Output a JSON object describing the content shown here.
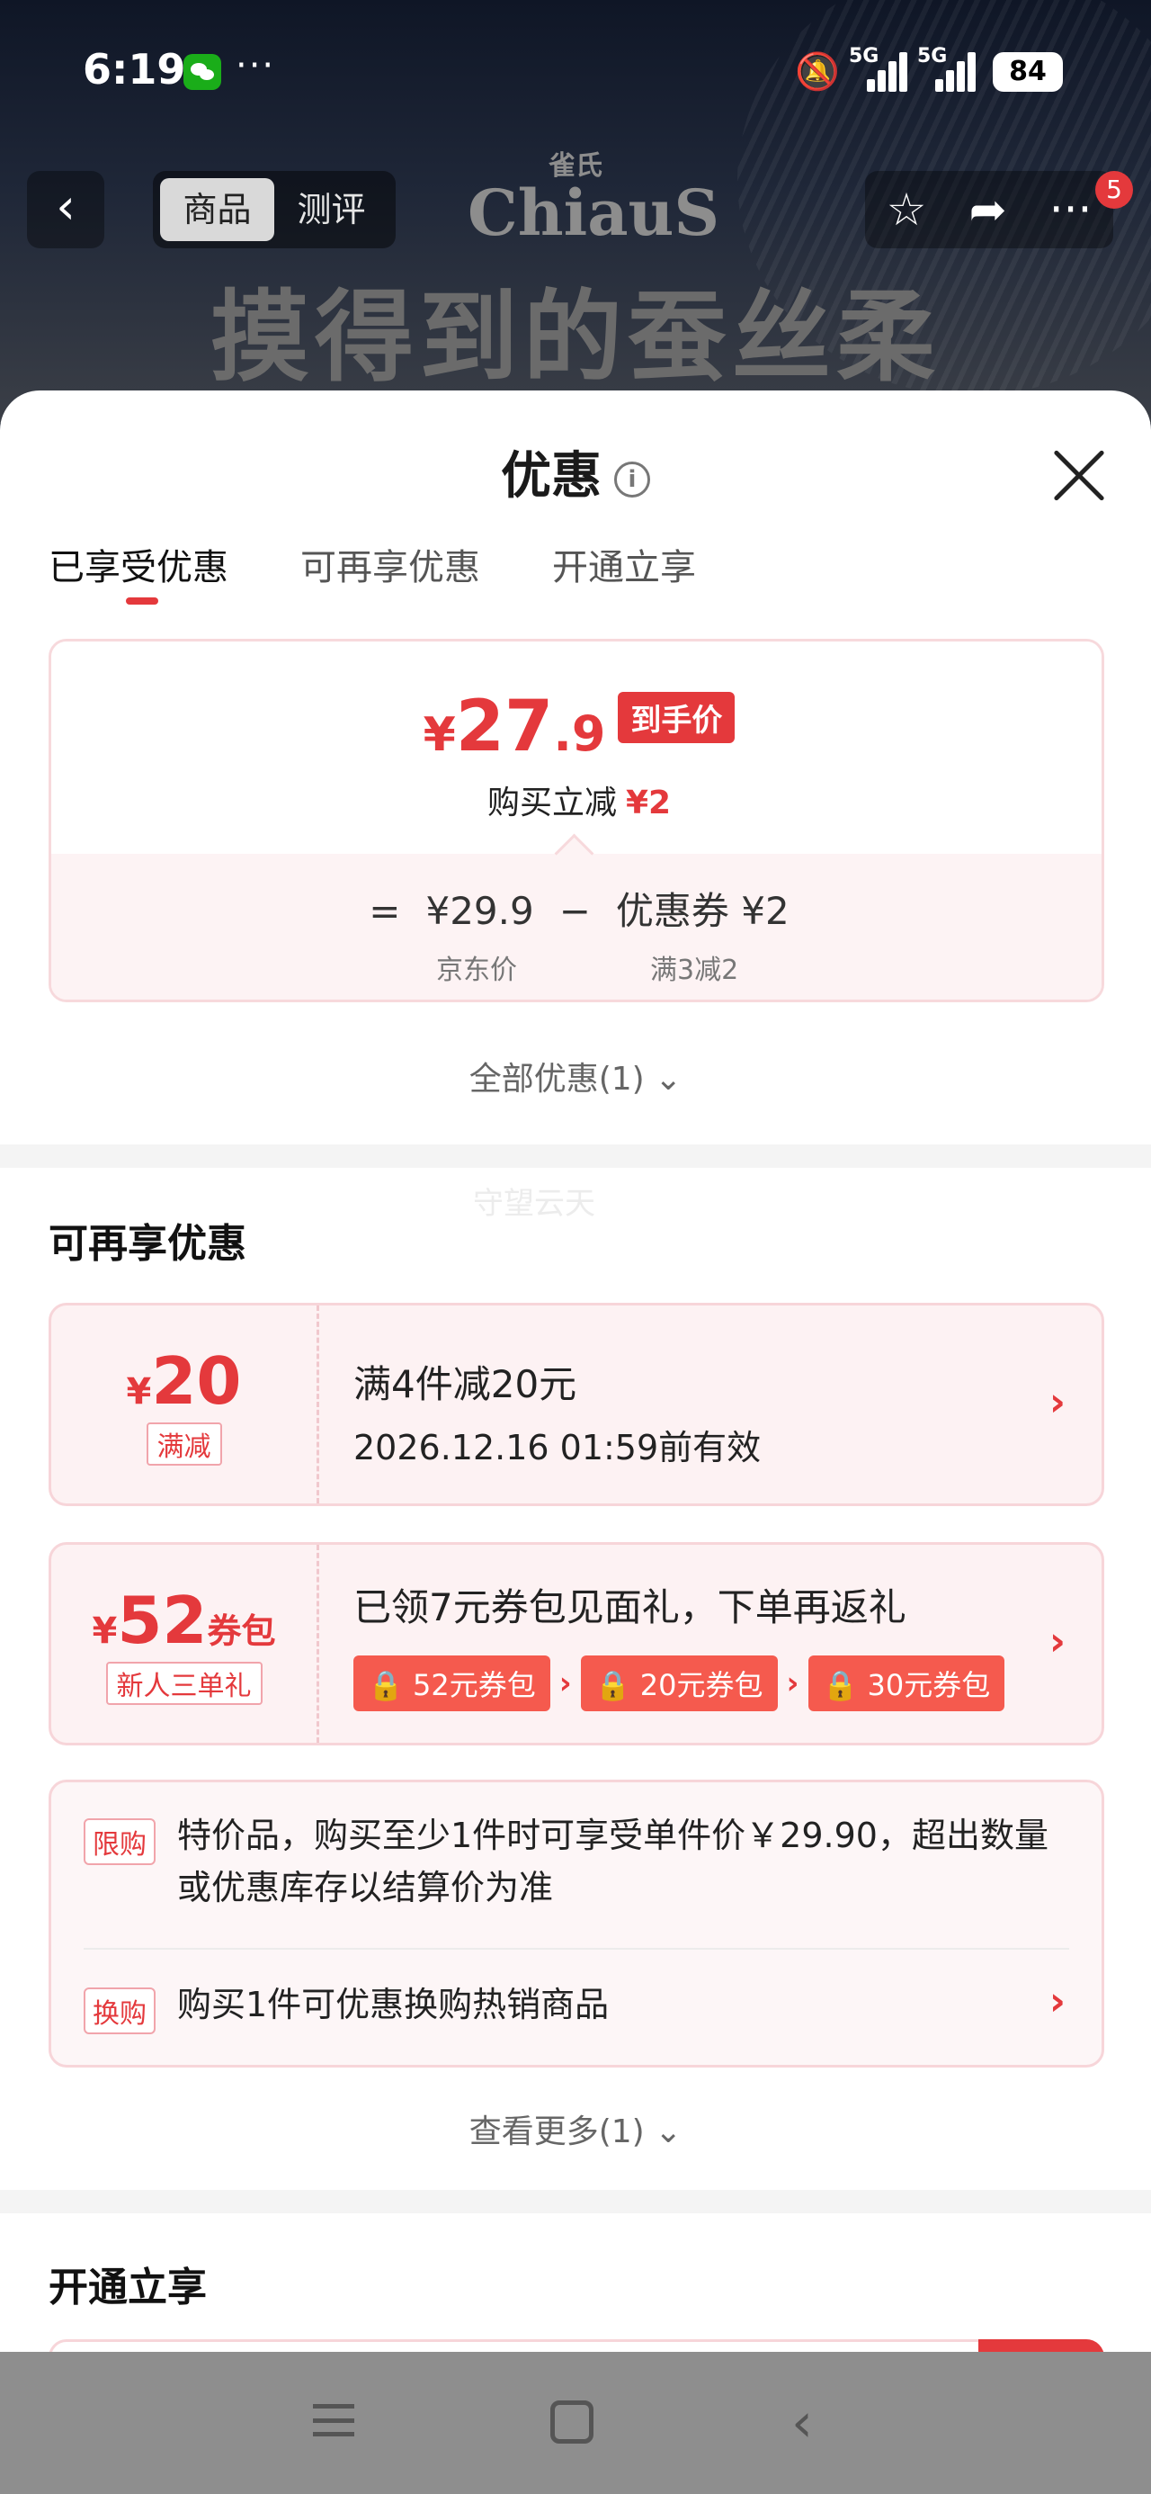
{
  "status_bar": {
    "time": "6:19",
    "more": "···",
    "network1": "5G",
    "network2": "5G",
    "battery": "84"
  },
  "nav": {
    "back": "‹",
    "segments": [
      "商品",
      "测评"
    ],
    "brand_cn": "雀氏",
    "brand_en": "ChiauS",
    "cart_badge": "5"
  },
  "hero": {
    "slogan": "摸得到的蚕丝柔"
  },
  "sheet": {
    "title": "优惠",
    "tabs": [
      "已享受优惠",
      "可再享优惠",
      "开通立享"
    ]
  },
  "price_card": {
    "currency": "¥",
    "price_int": "27",
    "price_dec": ".9",
    "tag": "到手价",
    "sub_label": "购买立减",
    "sub_value": "¥2",
    "formula_eq": "=",
    "jd_price": "¥29.9",
    "minus": "−",
    "coupon": "优惠券 ¥2",
    "jd_price_label": "京东价",
    "coupon_label": "满3减2"
  },
  "all_discounts": "全部优惠(1) ⌄",
  "watermark": "守望云天",
  "more_section": {
    "title": "可再享优惠",
    "coupon1": {
      "currency": "¥",
      "amount": "20",
      "tag": "满减",
      "title": "满4件减20元",
      "validity": "2026.12.16 01:59前有效"
    },
    "coupon2": {
      "currency": "¥",
      "amount": "52",
      "suffix": "券包",
      "tag": "新人三单礼",
      "title": "已领7元券包见面礼，下单再返礼",
      "packs": [
        "52元券包",
        "20元券包",
        "30元券包"
      ]
    },
    "rule1": {
      "tag": "限购",
      "text": "特价品，购买至少1件时可享受单件价￥29.90，超出数量或优惠库存以结算价为准"
    },
    "rule2": {
      "tag": "换购",
      "text": "购买1件可优惠换购热销商品"
    },
    "see_more": "查看更多(1) ⌄"
  },
  "open_section": {
    "title": "开通立享"
  },
  "colors": {
    "accent": "#e4393c",
    "coupon_bg": "#fdf2f3"
  }
}
